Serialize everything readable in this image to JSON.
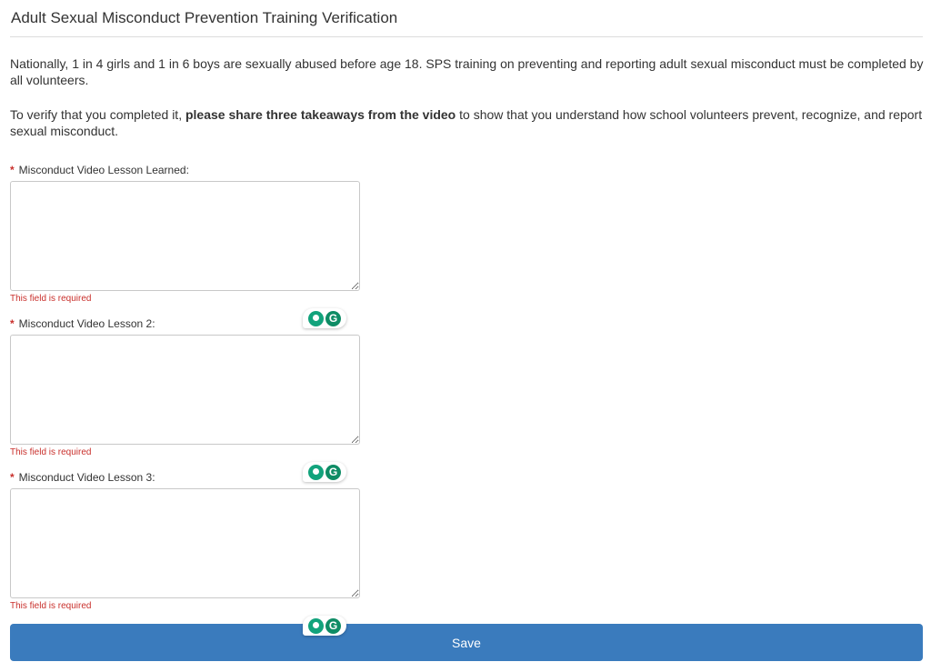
{
  "page": {
    "title": "Adult Sexual Misconduct Prevention Training Verification",
    "intro": "Nationally, 1 in 4 girls and 1 in 6 boys are sexually abused before age 18. SPS training on preventing and reporting adult sexual misconduct must be completed by all volunteers.",
    "verify_prefix": "To verify that you completed it, ",
    "verify_bold": "please share three takeaways from the video",
    "verify_suffix": " to show that you understand how school volunteers prevent, recognize, and report sexual misconduct."
  },
  "form": {
    "required_marker": "*",
    "fields": [
      {
        "label": "Misconduct Video Lesson Learned:",
        "value": "",
        "error": "This field is required"
      },
      {
        "label": "Misconduct Video Lesson 2:",
        "value": "",
        "error": "This field is required"
      },
      {
        "label": "Misconduct Video Lesson 3:",
        "value": "",
        "error": "This field is required"
      }
    ],
    "save_label": "Save"
  },
  "grammarly": {
    "g_glyph": "G",
    "icons": [
      "lightbulb-icon",
      "grammarly-g-icon"
    ]
  },
  "colors": {
    "button": "#3a7bbd",
    "error": "#c9302c",
    "grammarly_green": "#12a37c"
  }
}
